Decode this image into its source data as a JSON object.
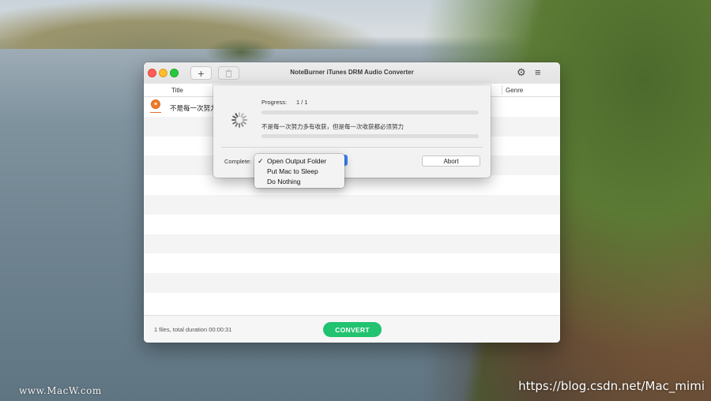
{
  "window": {
    "title": "NoteBurner iTunes DRM Audio Converter",
    "add_icon": "plus-icon",
    "delete_icon": "trash-icon",
    "settings_icon": "gear-icon",
    "menu_icon": "hamburger-menu-icon"
  },
  "table": {
    "columns": [
      "Title",
      "Genre"
    ],
    "rows": [
      {
        "icon": "music-note-icon",
        "title": "不是每一次努力"
      }
    ]
  },
  "status": {
    "summary": "1 files, total duration 00:00:31",
    "convert_label": "CONVERT"
  },
  "progress_sheet": {
    "progress_label": "Progress:",
    "progress_value": "1 / 1",
    "current_track": "不是每一次努力多有收获，但是每一次收获都必须努力",
    "complete_label": "Complete:",
    "abort_label": "Abort"
  },
  "complete_dropdown": {
    "options": [
      {
        "label": "Open Output Folder",
        "selected": true
      },
      {
        "label": "Put Mac to Sleep",
        "selected": false
      },
      {
        "label": "Do Nothing",
        "selected": false
      }
    ],
    "check_glyph": "✓"
  },
  "desktop": {
    "watermark_left": "www.MacW.com",
    "watermark_right": "https://blog.csdn.net/Mac_mimi"
  },
  "colors": {
    "convert_button": "#21c270",
    "track_icon": "#f07c2a",
    "popup_accent": "#3b82f6"
  }
}
